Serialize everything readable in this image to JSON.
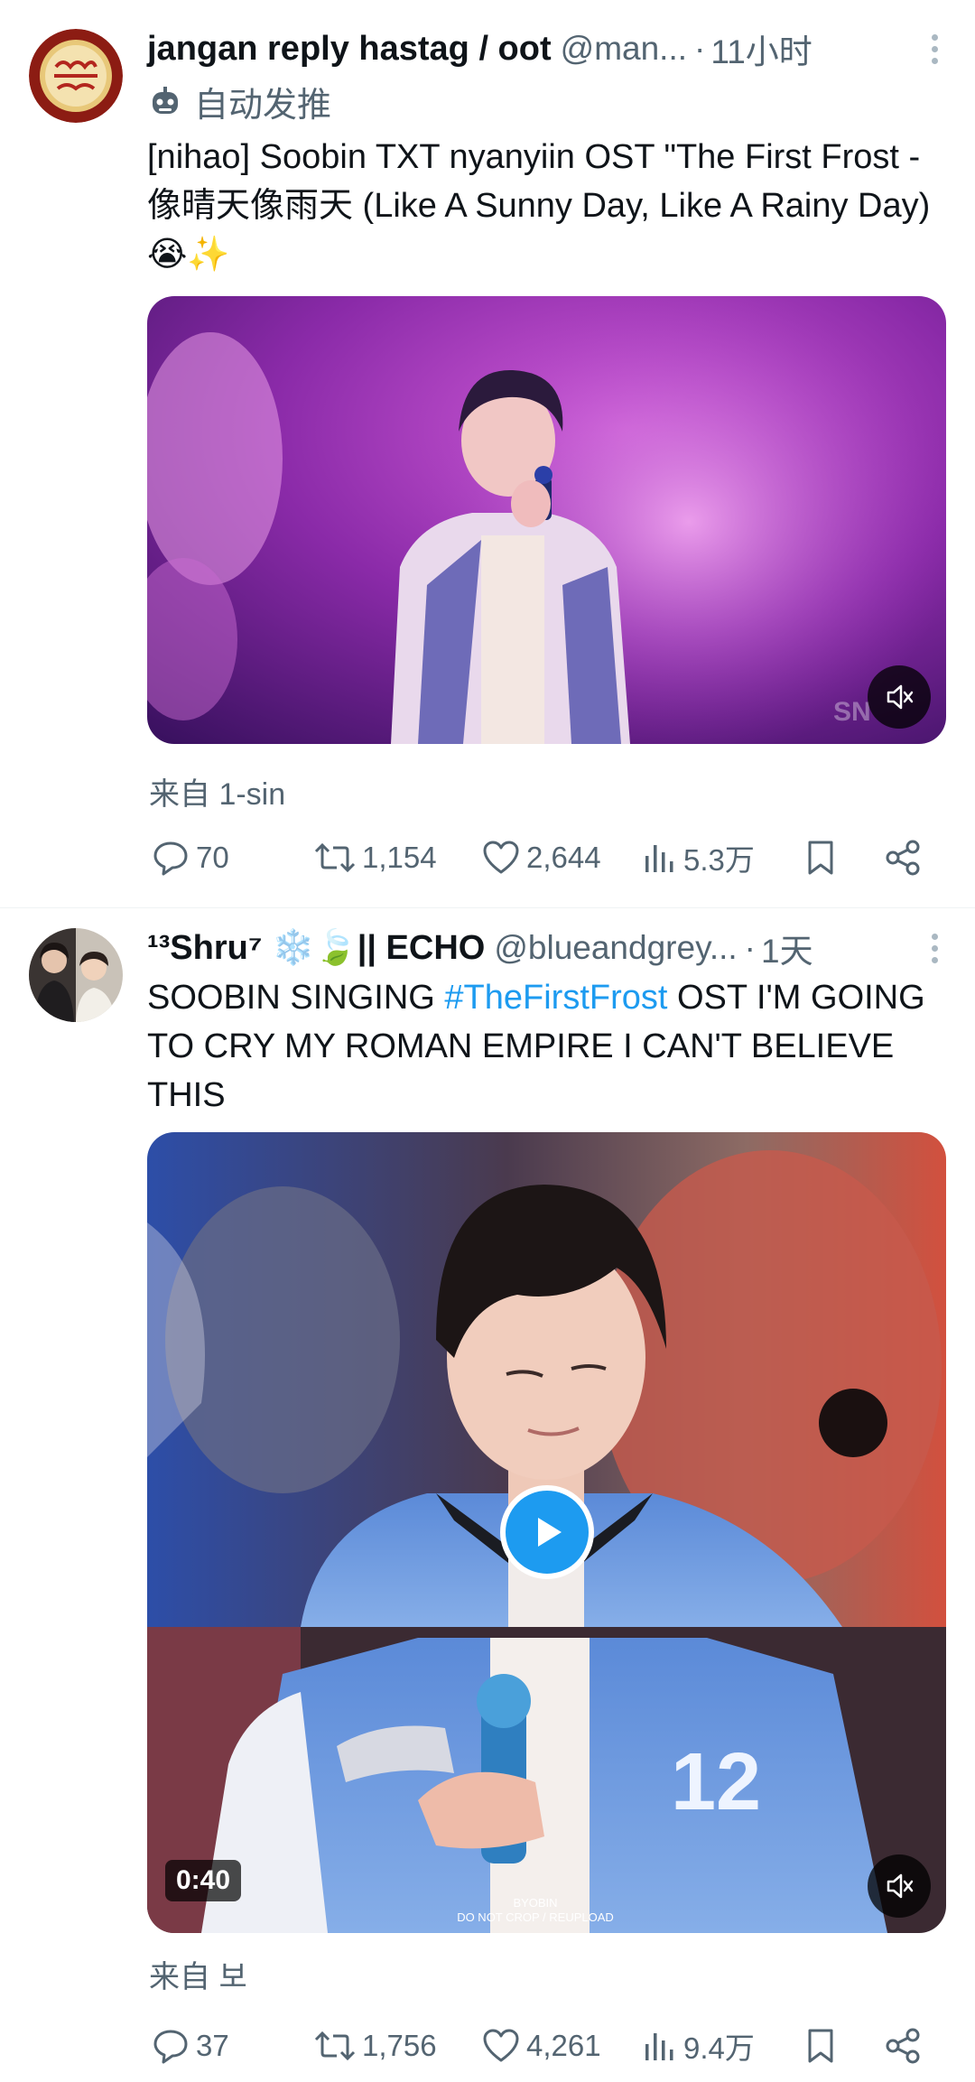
{
  "posts": [
    {
      "author_name": "jangan reply hastag / oot",
      "author_handle": "@man...",
      "separator": "·",
      "time": "11小时",
      "subline": "自动发推",
      "text": "[nihao] Soobin TXT nyanyiin OST \"The First Frost - 像晴天像雨天 (Like A Sunny Day, Like A Rainy Day) 😭✨",
      "source": "来自 1-sin",
      "replies": "70",
      "reposts": "1,154",
      "likes": "2,644",
      "views": "5.3万",
      "media_watermark": "SN"
    },
    {
      "author_name": "¹³Shru⁷ ❄️🍃|| ECHO",
      "author_handle": "@blueandgrey...",
      "separator": "·",
      "time": "1天",
      "text_before": "SOOBIN SINGING ",
      "hashtag": "#TheFirstFrost",
      "text_after": " OST I'M GOING TO CRY MY ROMAN EMPIRE I CAN'T BELIEVE THIS",
      "video_duration": "0:40",
      "video_caption_1": "BYOBIN",
      "video_caption_2": "DO NOT CROP / REUPLOAD",
      "jersey_number": "12",
      "source": "来自 보",
      "replies": "37",
      "reposts": "1,756",
      "likes": "4,261",
      "views": "9.4万"
    }
  ],
  "icons": {
    "reply": "speech-bubble-icon",
    "repost": "repost-arrows-icon",
    "like": "heart-icon",
    "views": "bar-chart-icon",
    "bookmark": "bookmark-icon",
    "share": "share-icon",
    "mute": "muted-speaker-icon",
    "play": "play-icon",
    "robot": "robot-icon"
  },
  "colors": {
    "accent": "#1d9bf0",
    "text": "#0f1419",
    "secondary": "#536471"
  }
}
